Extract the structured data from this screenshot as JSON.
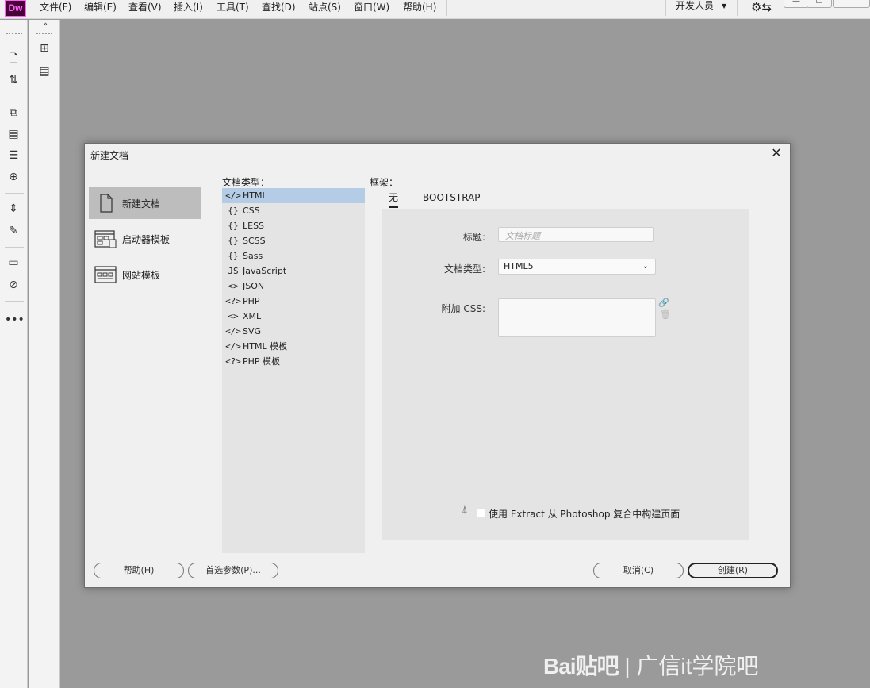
{
  "app": {
    "logo": "Dw",
    "workspace": "开发人员"
  },
  "menu": [
    "文件(F)",
    "编辑(E)",
    "查看(V)",
    "插入(I)",
    "工具(T)",
    "查找(D)",
    "站点(S)",
    "窗口(W)",
    "帮助(H)"
  ],
  "toolbar_icons": [
    "new-file-icon",
    "file-transfer-icon",
    "code-view-icon",
    "live-view-icon",
    "indent-icon",
    "target-icon",
    "expand-icon",
    "wand-icon",
    "comment-icon",
    "comment-remove-icon",
    "more-icon"
  ],
  "toolbar2_icons": [
    "site-map-icon",
    "code-navigator-icon"
  ],
  "dialog": {
    "title": "新建文档",
    "categories": [
      {
        "label": "新建文档",
        "selected": true
      },
      {
        "label": "启动器模板",
        "selected": false
      },
      {
        "label": "网站模板",
        "selected": false
      }
    ],
    "doc_type_label": "文档类型：",
    "doc_types": [
      {
        "icon": "</>",
        "label": "HTML",
        "selected": true
      },
      {
        "icon": "{}",
        "label": "CSS"
      },
      {
        "icon": "{}",
        "label": "LESS"
      },
      {
        "icon": "{}",
        "label": "SCSS"
      },
      {
        "icon": "{}",
        "label": "Sass"
      },
      {
        "icon": "JS",
        "label": "JavaScript"
      },
      {
        "icon": "<>",
        "label": "JSON"
      },
      {
        "icon": "<?>",
        "label": "PHP"
      },
      {
        "icon": "<>",
        "label": "XML"
      },
      {
        "icon": "</>",
        "label": "SVG"
      },
      {
        "icon": "</>",
        "label": "HTML 模板"
      },
      {
        "icon": "<?>",
        "label": "PHP 模板"
      }
    ],
    "framework_label": "框架：",
    "tabs": [
      "无",
      "BOOTSTRAP"
    ],
    "form": {
      "title_label": "标题:",
      "title_placeholder": "文档标题",
      "doctype_label": "文档类型:",
      "doctype_value": "HTML5",
      "css_label": "附加 CSS:"
    },
    "extract_label": "使用 Extract 从 Photoshop 复合中构建页面",
    "buttons": {
      "help": "帮助(H)",
      "prefs": "首选参数(P)...",
      "cancel": "取消(C)",
      "create": "创建(R)"
    }
  },
  "watermark": {
    "brand": "Bai贴吧",
    "text": "| 广信it学院吧"
  }
}
